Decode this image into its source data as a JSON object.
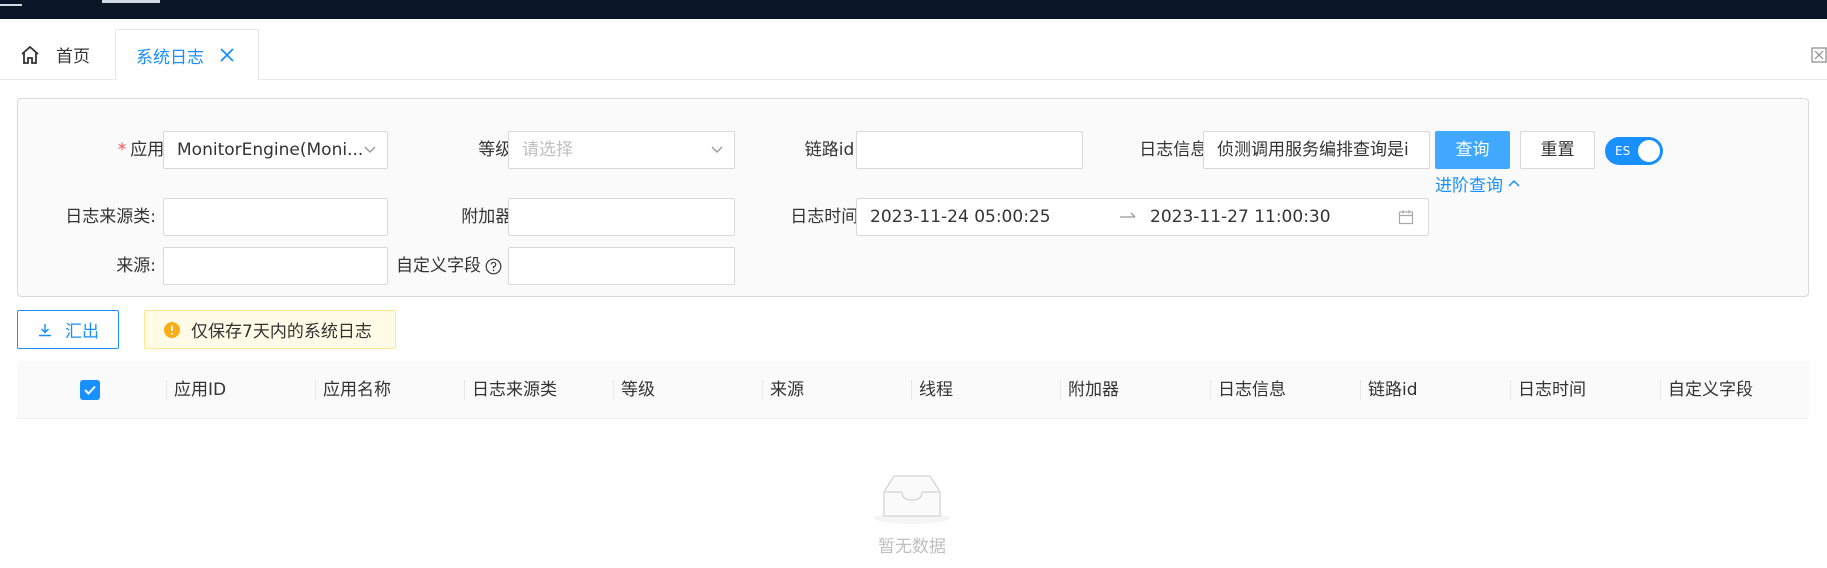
{
  "tabs": {
    "home_label": "首页",
    "active_label": "系统日志"
  },
  "filters": {
    "app_label": "应用:",
    "app_value": "MonitorEngine(Moni...",
    "level_label": "等级:",
    "level_placeholder": "请选择",
    "trace_label": "链路id:",
    "trace_value": "",
    "loginfo_label": "日志信息:",
    "loginfo_value": "侦测调用服务编排查询是i",
    "source_class_label": "日志来源类:",
    "appender_label": "附加器:",
    "logtime_label": "日志时间:",
    "time_start": "2023-11-24 05:00:25",
    "time_end": "2023-11-27 11:00:30",
    "source_label": "来源:",
    "custom_label": "自定义字段",
    "query_button": "查询",
    "reset_button": "重置",
    "switch_label": "ES",
    "advanced_link": "进阶查询"
  },
  "toolbar": {
    "export_label": "汇出",
    "notice": "仅保存7天内的系统日志"
  },
  "table": {
    "columns": [
      "应用ID",
      "应用名称",
      "日志来源类",
      "等级",
      "来源",
      "线程",
      "附加器",
      "日志信息",
      "链路id",
      "日志时间",
      "自定义字段"
    ],
    "empty_text": "暂无数据"
  },
  "colors": {
    "primary": "#1890ff",
    "primary_light": "#40a9ff",
    "topbar": "#0a1628",
    "warning": "#faad14"
  }
}
